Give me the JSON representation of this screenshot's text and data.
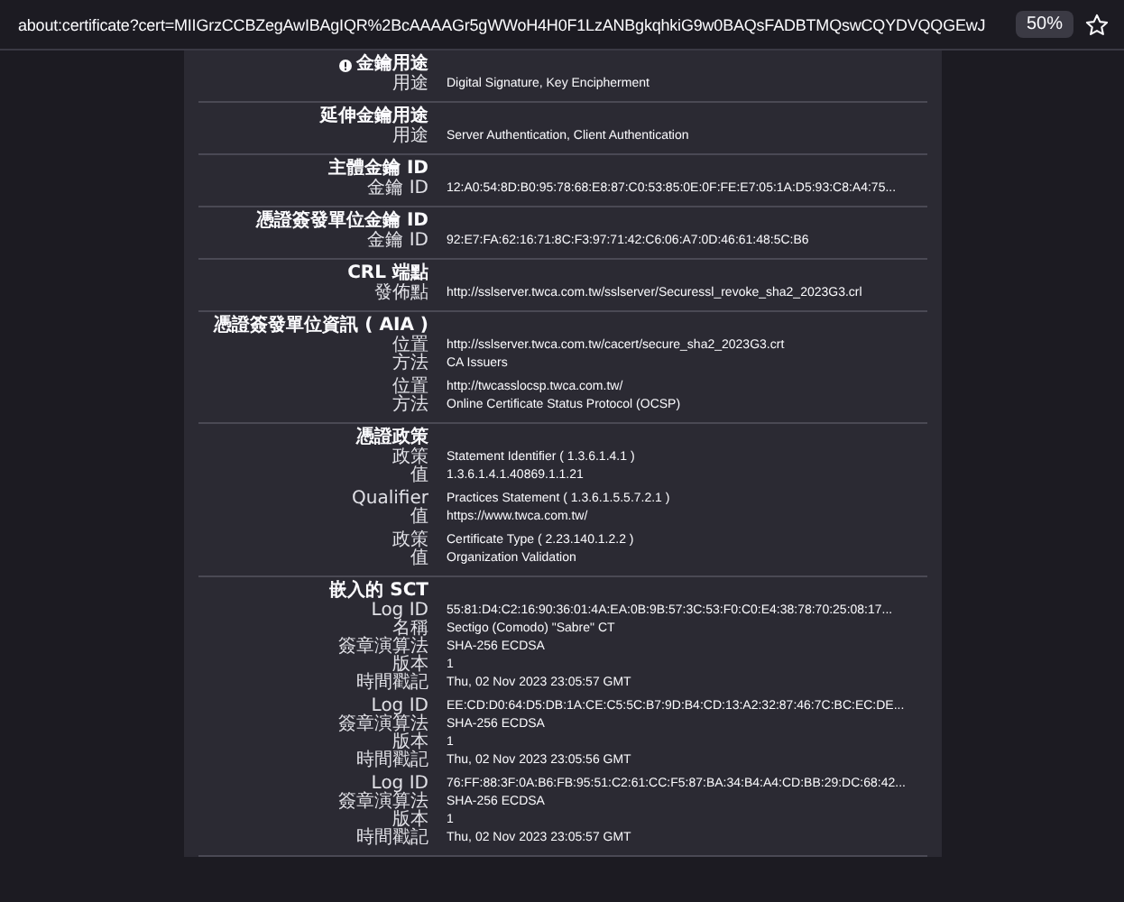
{
  "address_bar": {
    "url": "about:certificate?cert=MIIGrzCCBZegAwIBAgIQR%2BcAAAAGr5gWWoH4H0F1LzANBgkqhkiG9w0BAQsFADBTMQswCQYDVQQGEwJ",
    "zoom": "50%"
  },
  "sections": [
    {
      "title": "金鑰用途",
      "critical": true,
      "groups": [
        [
          {
            "label": "用途",
            "value": "Digital Signature, Key Encipherment"
          }
        ]
      ]
    },
    {
      "title": "延伸金鑰用途",
      "critical": false,
      "groups": [
        [
          {
            "label": "用途",
            "value": "Server Authentication, Client Authentication"
          }
        ]
      ]
    },
    {
      "title": "主體金鑰 ID",
      "critical": false,
      "groups": [
        [
          {
            "label": "金鑰 ID",
            "value": "12:A0:54:8D:B0:95:78:68:E8:87:C0:53:85:0E:0F:FE:E7:05:1A:D5:93:C8:A4:75..."
          }
        ]
      ]
    },
    {
      "title": "憑證簽發單位金鑰 ID",
      "critical": false,
      "groups": [
        [
          {
            "label": "金鑰 ID",
            "value": "92:E7:FA:62:16:71:8C:F3:97:71:42:C6:06:A7:0D:46:61:48:5C:B6"
          }
        ]
      ]
    },
    {
      "title": "CRL 端點",
      "critical": false,
      "groups": [
        [
          {
            "label": "發佈點",
            "value": "http://sslserver.twca.com.tw/sslserver/Securessl_revoke_sha2_2023G3.crl"
          }
        ]
      ]
    },
    {
      "title": "憑證簽發單位資訊 ( AIA )",
      "critical": false,
      "groups": [
        [
          {
            "label": "位置",
            "value": "http://sslserver.twca.com.tw/cacert/secure_sha2_2023G3.crt"
          },
          {
            "label": "方法",
            "value": "CA Issuers"
          }
        ],
        [
          {
            "label": "位置",
            "value": "http://twcasslocsp.twca.com.tw/"
          },
          {
            "label": "方法",
            "value": "Online Certificate Status Protocol (OCSP)"
          }
        ]
      ]
    },
    {
      "title": "憑證政策",
      "critical": false,
      "groups": [
        [
          {
            "label": "政策",
            "value": "Statement Identifier ( 1.3.6.1.4.1 )"
          },
          {
            "label": "值",
            "value": "1.3.6.1.4.1.40869.1.1.21"
          }
        ],
        [
          {
            "label": "Qualifier",
            "value": "Practices Statement ( 1.3.6.1.5.5.7.2.1 )"
          },
          {
            "label": "值",
            "value": "https://www.twca.com.tw/"
          }
        ],
        [
          {
            "label": "政策",
            "value": "Certificate Type ( 2.23.140.1.2.2 )"
          },
          {
            "label": "值",
            "value": "Organization Validation"
          }
        ]
      ]
    },
    {
      "title": "嵌入的 SCT",
      "critical": false,
      "groups": [
        [
          {
            "label": "Log ID",
            "value": "55:81:D4:C2:16:90:36:01:4A:EA:0B:9B:57:3C:53:F0:C0:E4:38:78:70:25:08:17..."
          },
          {
            "label": "名稱",
            "value": "Sectigo (Comodo) \"Sabre\" CT"
          },
          {
            "label": "簽章演算法",
            "value": "SHA-256 ECDSA"
          },
          {
            "label": "版本",
            "value": "1"
          },
          {
            "label": "時間戳記",
            "value": "Thu, 02 Nov 2023 23:05:57 GMT"
          }
        ],
        [
          {
            "label": "Log ID",
            "value": "EE:CD:D0:64:D5:DB:1A:CE:C5:5C:B7:9D:B4:CD:13:A2:32:87:46:7C:BC:EC:DE..."
          },
          {
            "label": "簽章演算法",
            "value": "SHA-256 ECDSA"
          },
          {
            "label": "版本",
            "value": "1"
          },
          {
            "label": "時間戳記",
            "value": "Thu, 02 Nov 2023 23:05:56 GMT"
          }
        ],
        [
          {
            "label": "Log ID",
            "value": "76:FF:88:3F:0A:B6:FB:95:51:C2:61:CC:F5:87:BA:34:B4:A4:CD:BB:29:DC:68:42..."
          },
          {
            "label": "簽章演算法",
            "value": "SHA-256 ECDSA"
          },
          {
            "label": "版本",
            "value": "1"
          },
          {
            "label": "時間戳記",
            "value": "Thu, 02 Nov 2023 23:05:57 GMT"
          }
        ]
      ]
    }
  ]
}
